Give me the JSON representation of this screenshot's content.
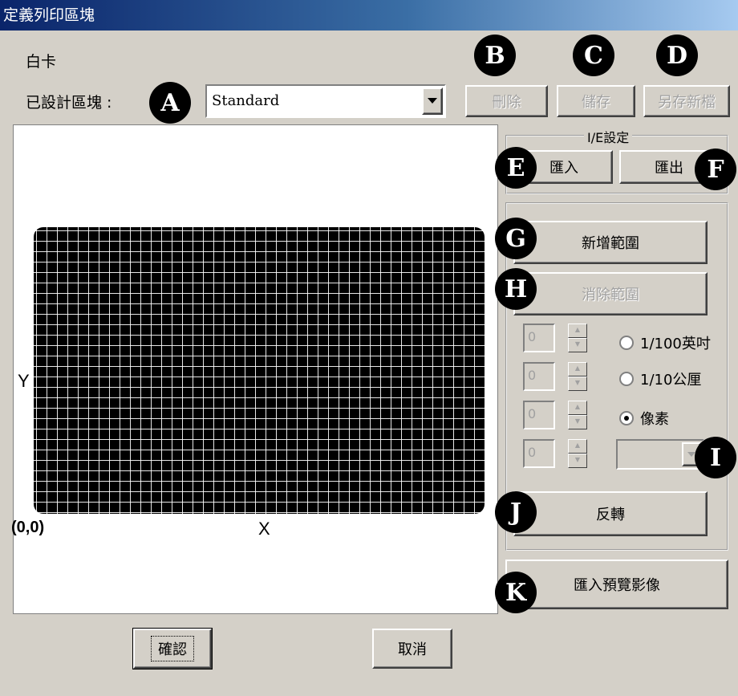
{
  "window": {
    "title": "定義列印區塊"
  },
  "card_type": "白卡",
  "block_selector": {
    "label": "已設計區塊 :",
    "value": "Standard"
  },
  "toolbar": {
    "delete": "刪除",
    "save": "儲存",
    "save_as": "另存新檔"
  },
  "ie_settings": {
    "title": "I/E設定",
    "import": "匯入",
    "export": "匯出"
  },
  "range": {
    "add": "新增範圍",
    "clear": "消除範圍",
    "invert": "反轉"
  },
  "fields": [
    "0",
    "0",
    "0",
    "0"
  ],
  "units": [
    {
      "label": "1/100英吋",
      "selected": false
    },
    {
      "label": "1/10公厘",
      "selected": false
    },
    {
      "label": "像素",
      "selected": true
    }
  ],
  "preview_import": "匯入預覽影像",
  "canvas": {
    "y_label": "Y",
    "x_label": "X",
    "origin_label": "(0,0)"
  },
  "footer": {
    "ok": "確認",
    "cancel": "取消"
  },
  "callouts": [
    "A",
    "B",
    "C",
    "D",
    "E",
    "F",
    "G",
    "H",
    "I",
    "J",
    "K"
  ]
}
